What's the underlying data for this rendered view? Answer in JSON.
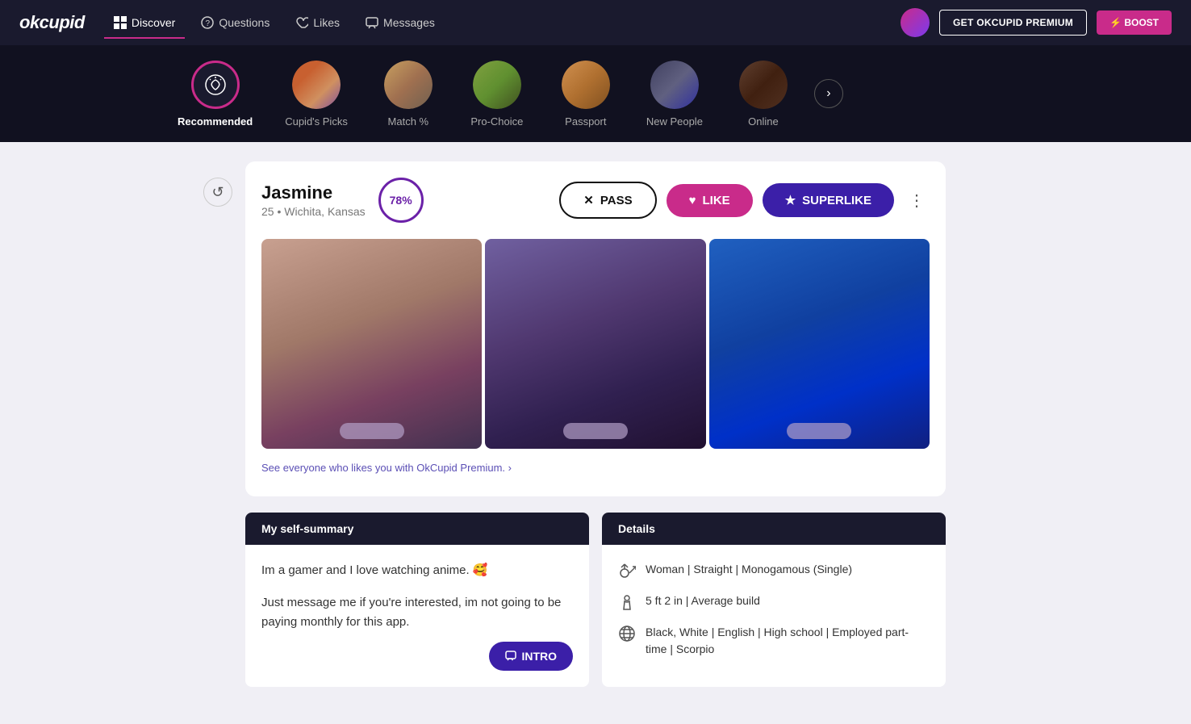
{
  "brand": "okcupid",
  "nav": {
    "items": [
      {
        "label": "Discover",
        "icon": "grid-icon",
        "active": true
      },
      {
        "label": "Questions",
        "icon": "question-icon",
        "active": false
      },
      {
        "label": "Likes",
        "icon": "heart-icon",
        "active": false
      },
      {
        "label": "Messages",
        "icon": "message-icon",
        "active": false
      }
    ],
    "premium_btn": "GET OKCUPID PREMIUM",
    "boost_btn": "⚡ BOOST"
  },
  "categories": [
    {
      "label": "Recommended",
      "active": true,
      "type": "icon"
    },
    {
      "label": "Cupid's Picks",
      "active": false,
      "type": "image"
    },
    {
      "label": "Match %",
      "active": false,
      "type": "image"
    },
    {
      "label": "Pro-Choice",
      "active": false,
      "type": "image"
    },
    {
      "label": "Passport",
      "active": false,
      "type": "image"
    },
    {
      "label": "New People",
      "active": false,
      "type": "image"
    },
    {
      "label": "Online",
      "active": false,
      "type": "image"
    }
  ],
  "profile": {
    "name": "Jasmine",
    "age": "25",
    "location": "Wichita, Kansas",
    "match_percent": "78%",
    "actions": {
      "pass": "PASS",
      "like": "LIKE",
      "superlike": "SUPERLIKE"
    }
  },
  "premium_prompt": "See everyone who likes you with OkCupid Premium. ›",
  "self_summary": {
    "header": "My self-summary",
    "line1": "Im a gamer and I love watching anime. 🥰",
    "line2": "Just message me if you're interested, im not going to be paying monthly for this app.",
    "intro_btn": "INTRO"
  },
  "details": {
    "header": "Details",
    "rows": [
      {
        "icon": "gender-icon",
        "text": "Woman | Straight | Monogamous (Single)"
      },
      {
        "icon": "height-icon",
        "text": "5 ft 2 in | Average build"
      },
      {
        "icon": "globe-icon",
        "text": "Black, White | English | High school | Employed part-time | Scorpio"
      }
    ]
  }
}
